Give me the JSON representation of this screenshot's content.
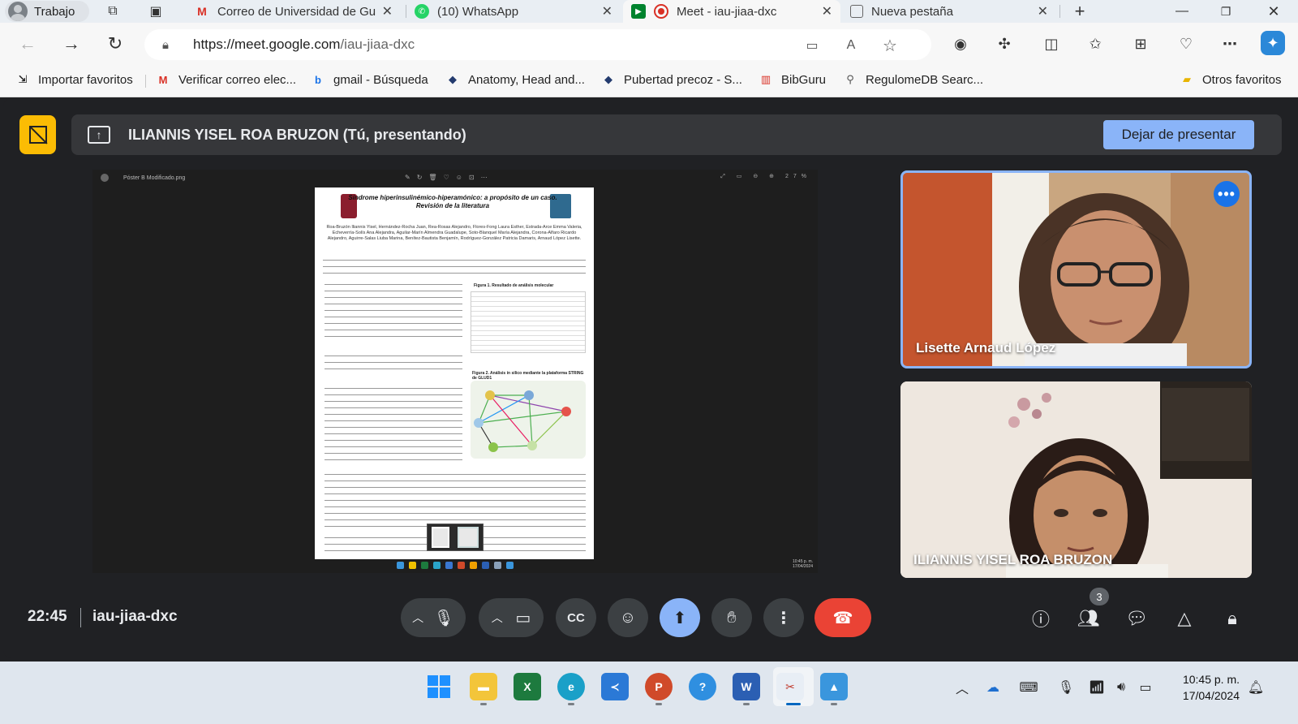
{
  "browser": {
    "profile_label": "Trabajo",
    "tabs": [
      {
        "label": "Correo de Universidad de Gu",
        "icon": "gmail-icon",
        "active": false
      },
      {
        "label": "(10) WhatsApp",
        "icon": "whatsapp-icon",
        "active": false
      },
      {
        "label": "Meet - iau-jiaa-dxc",
        "icon": "meet-icon",
        "active": true
      },
      {
        "label": "Nueva pestaña",
        "icon": "new-tab-icon",
        "active": false
      }
    ],
    "url_host": "https://meet.google.com",
    "url_path": "/iau-jiaa-dxc",
    "bookmarks": [
      {
        "label": "Importar favoritos",
        "icon": "import-icon"
      },
      {
        "label": "Verificar correo elec...",
        "icon": "gmail-icon"
      },
      {
        "label": "gmail - Búsqueda",
        "icon": "bing-icon"
      },
      {
        "label": "Anatomy, Head and...",
        "icon": "bookmark-icon"
      },
      {
        "label": "Pubertad precoz - S...",
        "icon": "bookmark-icon"
      },
      {
        "label": "BibGuru",
        "icon": "bibguru-icon"
      },
      {
        "label": "RegulomeDB Searc...",
        "icon": "regulome-icon"
      }
    ],
    "other_favorites": "Otros favoritos"
  },
  "meet": {
    "presenting_title": "ILIANNIS YISEL ROA BRUZON (Tú, presentando)",
    "stop_presenting": "Dejar de presentar",
    "shared_file_name": "Póster B Modificado.png",
    "shared_zoom": "27%",
    "shared_clock_time": "10:45 p. m.",
    "shared_clock_date": "17/04/2024",
    "poster_title_1": "Síndrome hiperinsulinémico-hiperamónico: a propósito de un caso.",
    "poster_title_2": "Revisión de la literatura",
    "poster_authors": "Roa-Bruzón Iliannis Yisel, Hernández-Rocha Juan, Rea-Rosas Alejandro, Flores-Fong Laura Esther, Estrada-Arce Emma Valeria, Echeverría-Solís Ana Alejandra, Aguilar-Marín Almendra Guadalupe, Soto-Blanquel María Alejandra, Corona-Alfaro Ricardo Alejandro, Aguirre-Salas Liuba Marina, Benítez-Bautista Benjamín, Rodríguez-González Patricia Damaris, Arnaud López Lisette.",
    "poster_fig1_caption": "Figura 1. Resultado de análisis molecular",
    "poster_fig2_caption": "Figura 2. Análisis in silico mediante la plataforma STRING de GLUD1",
    "participants": [
      {
        "name": "Lisette Arnaud López",
        "active_speaker": true
      },
      {
        "name": "ILIANNIS YISEL ROA BRUZON",
        "active_speaker": false
      }
    ],
    "time": "22:45",
    "meeting_code": "iau-jiaa-dxc",
    "participant_count": "3"
  },
  "taskbar": {
    "time": "10:45 p. m.",
    "date": "17/04/2024",
    "apps": [
      "start-icon",
      "file-explorer-icon",
      "excel-icon",
      "edge-icon",
      "vscode-icon",
      "powerpoint-icon",
      "help-icon",
      "word-icon",
      "snipping-tool-icon",
      "photos-icon"
    ]
  },
  "colors": {
    "meet_bg": "#202124",
    "accent_blue": "#8ab4f8",
    "presenting_yellow": "#fbbc04",
    "end_call_red": "#ea4335"
  }
}
